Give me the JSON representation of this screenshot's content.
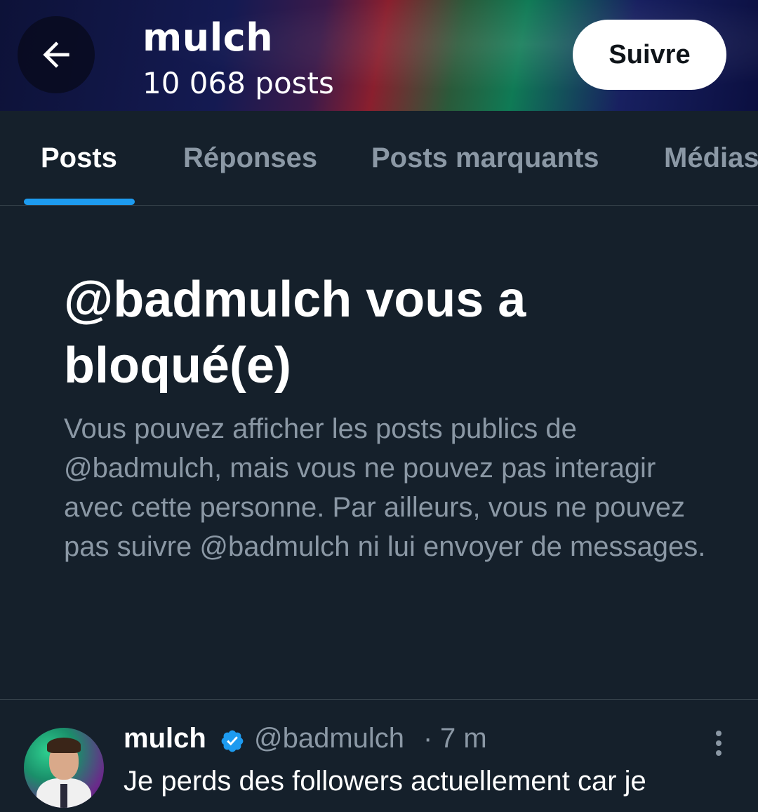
{
  "header": {
    "name": "mulch",
    "post_count": "10 068 posts",
    "follow_label": "Suivre",
    "back_icon": "arrow-left-icon"
  },
  "tabs": [
    {
      "label": "Posts",
      "active": true
    },
    {
      "label": "Réponses",
      "active": false
    },
    {
      "label": "Posts marquants",
      "active": false
    },
    {
      "label": "Médias",
      "active": false
    }
  ],
  "blocked": {
    "title": "@badmulch vous a bloqué(e)",
    "description": "Vous pouvez afficher les posts publics de @badmulch, mais vous ne pouvez pas interagir avec cette personne. Par ailleurs, vous ne pouvez pas suivre @badmulch ni lui envoyer de messages."
  },
  "post": {
    "author": "mulch",
    "verified_icon": "verified-badge-icon",
    "handle": "@badmulch",
    "separator": "·",
    "time": "7 m",
    "text": "Je perds des followers actuellement car je",
    "more_icon": "more-vertical-icon"
  },
  "colors": {
    "background": "#15202b",
    "accent": "#1d9bf0",
    "muted_text": "#8b98a5",
    "divider": "#38444d"
  }
}
